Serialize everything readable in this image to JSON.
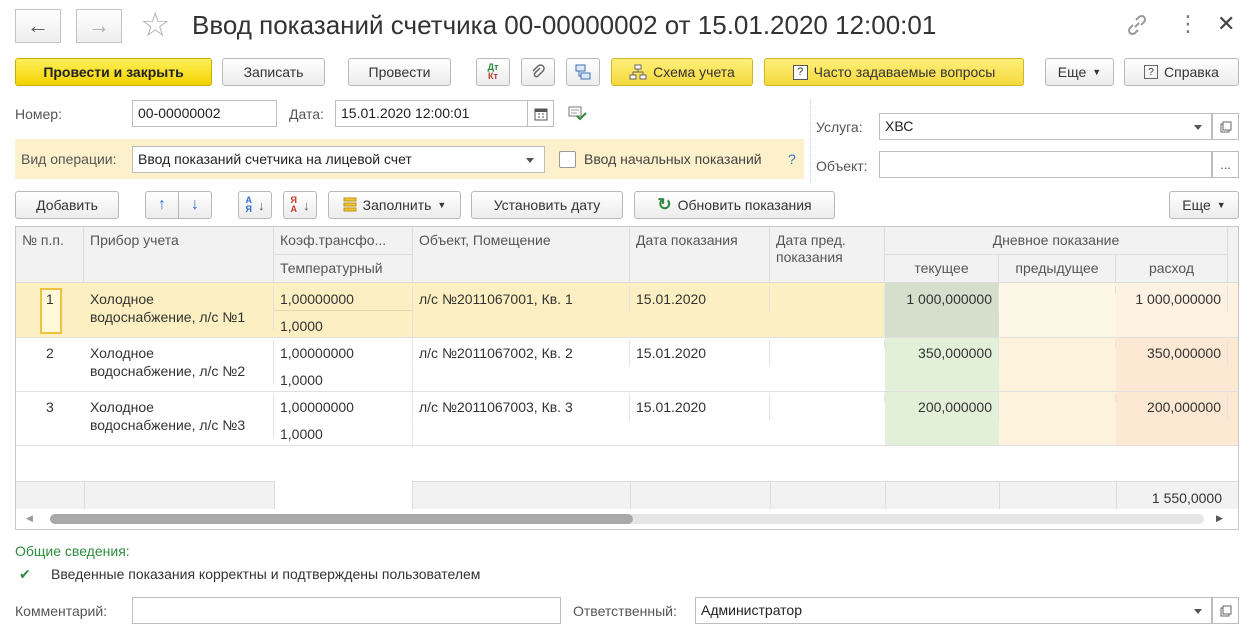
{
  "window": {
    "title": "Ввод показаний счетчика 00-00000002 от 15.01.2020 12:00:01"
  },
  "toolbar": {
    "post_close": "Провести и закрыть",
    "save": "Записать",
    "post": "Провести",
    "dtkt_top": "Дт",
    "dtkt_bottom": "Кт",
    "scheme": "Схема учета",
    "faq": "Часто задаваемые вопросы",
    "more": "Еще",
    "help": "Справка"
  },
  "form": {
    "number_label": "Номер:",
    "number_value": "00-00000002",
    "date_label": "Дата:",
    "date_value": "15.01.2020 12:00:01",
    "operation_label": "Вид операции:",
    "operation_value": "Ввод показаний счетчика на лицевой счет",
    "initial_readings_label": "Ввод начальных показаний",
    "question_mark": "?",
    "service_label": "Услуга:",
    "service_value": "ХВС",
    "object_label": "Объект:",
    "object_value": "",
    "ellipsis": "..."
  },
  "table_toolbar": {
    "add": "Добавить",
    "fill": "Заполнить",
    "set_date": "Установить дату",
    "refresh": "Обновить показания",
    "more": "Еще"
  },
  "table": {
    "headers": {
      "num": "№ п.п.",
      "device": "Прибор учета",
      "coef": "Коэф.трансфо...",
      "temp": "Температурный",
      "object": "Объект, Помещение",
      "date": "Дата показания",
      "prev_date_1": "Дата пред.",
      "prev_date_2": "показания",
      "day": "Дневное показание",
      "current": "текущее",
      "previous": "предыдущее",
      "consumption": "расход"
    },
    "rows": [
      {
        "num": "1",
        "device_1": "Холодное",
        "device_2": "водоснабжение, л/с №1",
        "coef": "1,00000000",
        "temp": "1,0000",
        "object": "л/с №2011067001, Кв. 1",
        "date": "15.01.2020",
        "prev_date": "",
        "current": "1 000,000000",
        "previous": "",
        "consumption": "1 000,000000"
      },
      {
        "num": "2",
        "device_1": "Холодное",
        "device_2": "водоснабжение, л/с №2",
        "coef": "1,00000000",
        "temp": "1,0000",
        "object": "л/с №2011067002, Кв. 2",
        "date": "15.01.2020",
        "prev_date": "",
        "current": "350,000000",
        "previous": "",
        "consumption": "350,000000"
      },
      {
        "num": "3",
        "device_1": "Холодное",
        "device_2": "водоснабжение, л/с №3",
        "coef": "1,00000000",
        "temp": "1,0000",
        "object": "л/с №2011067003, Кв. 3",
        "date": "15.01.2020",
        "prev_date": "",
        "current": "200,000000",
        "previous": "",
        "consumption": "200,000000"
      }
    ],
    "footer_total": "1 550,0000"
  },
  "general": {
    "title": "Общие сведения:",
    "message": "Введенные показания корректны и подтверждены пользователем"
  },
  "bottom": {
    "comment_label": "Комментарий:",
    "comment_value": "",
    "responsible_label": "Ответственный:",
    "responsible_value": "Администратор"
  },
  "colors": {
    "accent_yellow": "#f4d83c",
    "operation_bg": "#fdf1cc",
    "selected_row": "#fcf0c2",
    "current_col": "#e2f0d9",
    "previous_col": "#fdf2dc",
    "consumption_col": "#fde8d4",
    "link_green": "#2e8b3c"
  },
  "icons": {
    "back": "arrow-left-icon",
    "forward": "arrow-right-icon",
    "favorite": "star-icon",
    "link": "link-icon",
    "menu": "kebab-icon",
    "close": "close-icon"
  }
}
